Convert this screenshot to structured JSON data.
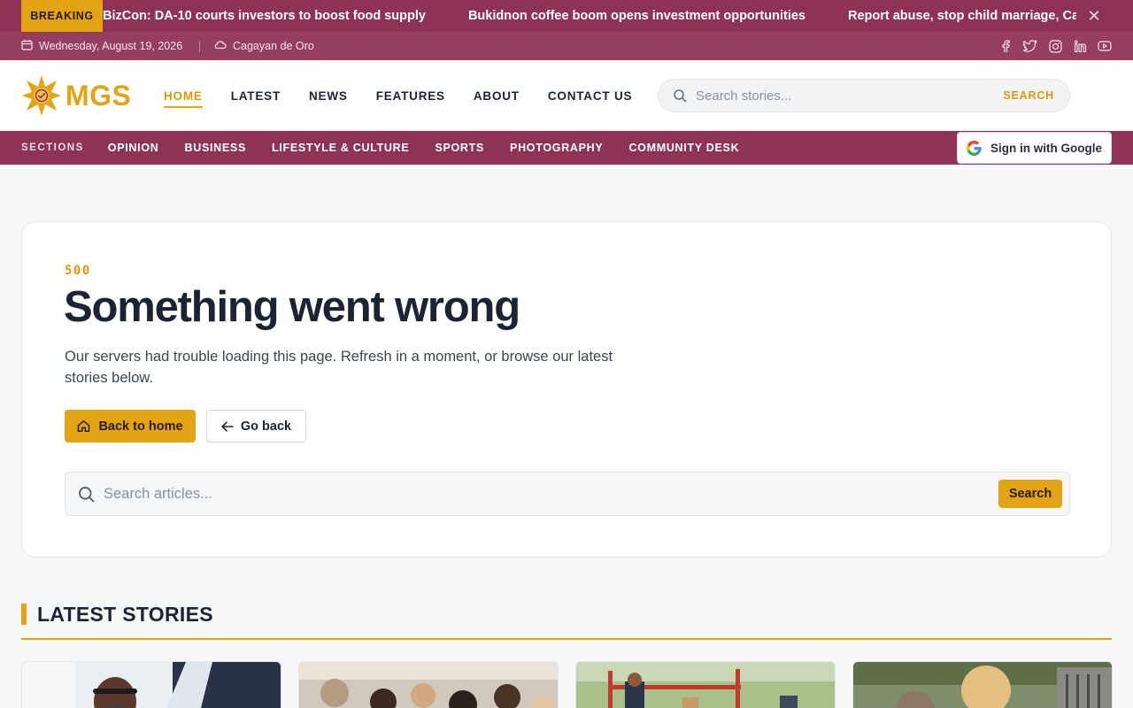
{
  "ticker": {
    "badge": "BREAKING",
    "items": [
      "BizCon: DA-10 courts investors to boost food supply",
      "Bukidnon coffee boom opens investment opportunities",
      "Report abuse, stop child marriage, Camigui"
    ]
  },
  "infobar": {
    "date": "Wednesday, August 19, 2026",
    "location": "Cagayan de Oro",
    "socials": [
      "facebook-icon",
      "twitter-icon",
      "instagram-icon",
      "linkedin-icon",
      "youtube-icon"
    ]
  },
  "header": {
    "logo_text": "MGS",
    "nav": [
      "HOME",
      "LATEST",
      "NEWS",
      "FEATURES",
      "ABOUT",
      "CONTACT US"
    ],
    "active_nav": "HOME",
    "search_placeholder": "Search stories...",
    "search_button": "SEARCH"
  },
  "sections": {
    "label": "SECTIONS",
    "items": [
      "OPINION",
      "BUSINESS",
      "LIFESTYLE & CULTURE",
      "SPORTS",
      "PHOTOGRAPHY",
      "COMMUNITY DESK"
    ],
    "sign_in": "Sign in with Google"
  },
  "error": {
    "code": "500",
    "title": "Something went wrong",
    "description": "Our servers had trouble loading this page. Refresh in a moment, or browse our latest stories below.",
    "primary_button": "Back to home",
    "secondary_button": "Go back",
    "search_placeholder": "Search articles...",
    "search_button": "Search"
  },
  "latest": {
    "heading": "LATEST STORIES",
    "cards": [
      {
        "image": "portrait-man-glasses"
      },
      {
        "image": "crowd-seated"
      },
      {
        "image": "outdoor-event"
      },
      {
        "image": "street-scene"
      }
    ]
  },
  "colors": {
    "brand_maroon": "#8e3358",
    "accent_gold": "#e3a413",
    "text_dark": "#1c2333"
  }
}
